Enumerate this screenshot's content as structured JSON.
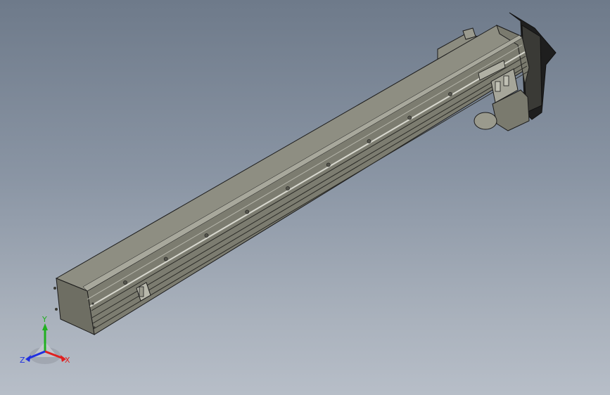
{
  "viewport": {
    "background_top": "#6e7a8a",
    "background_bottom": "#b7bec8"
  },
  "model": {
    "body_color_top": "#8f8f82",
    "body_color_side": "#7d7d71",
    "body_color_front": "#6b6b60",
    "edge_color": "#1b1b1b",
    "rail_color": "#cfcfc6",
    "motor_color": "#2a2a2a"
  },
  "triad": {
    "x_label": "X",
    "y_label": "Y",
    "z_label": "Z",
    "x_color": "#e02020",
    "y_color": "#20b020",
    "z_color": "#2030e0"
  }
}
